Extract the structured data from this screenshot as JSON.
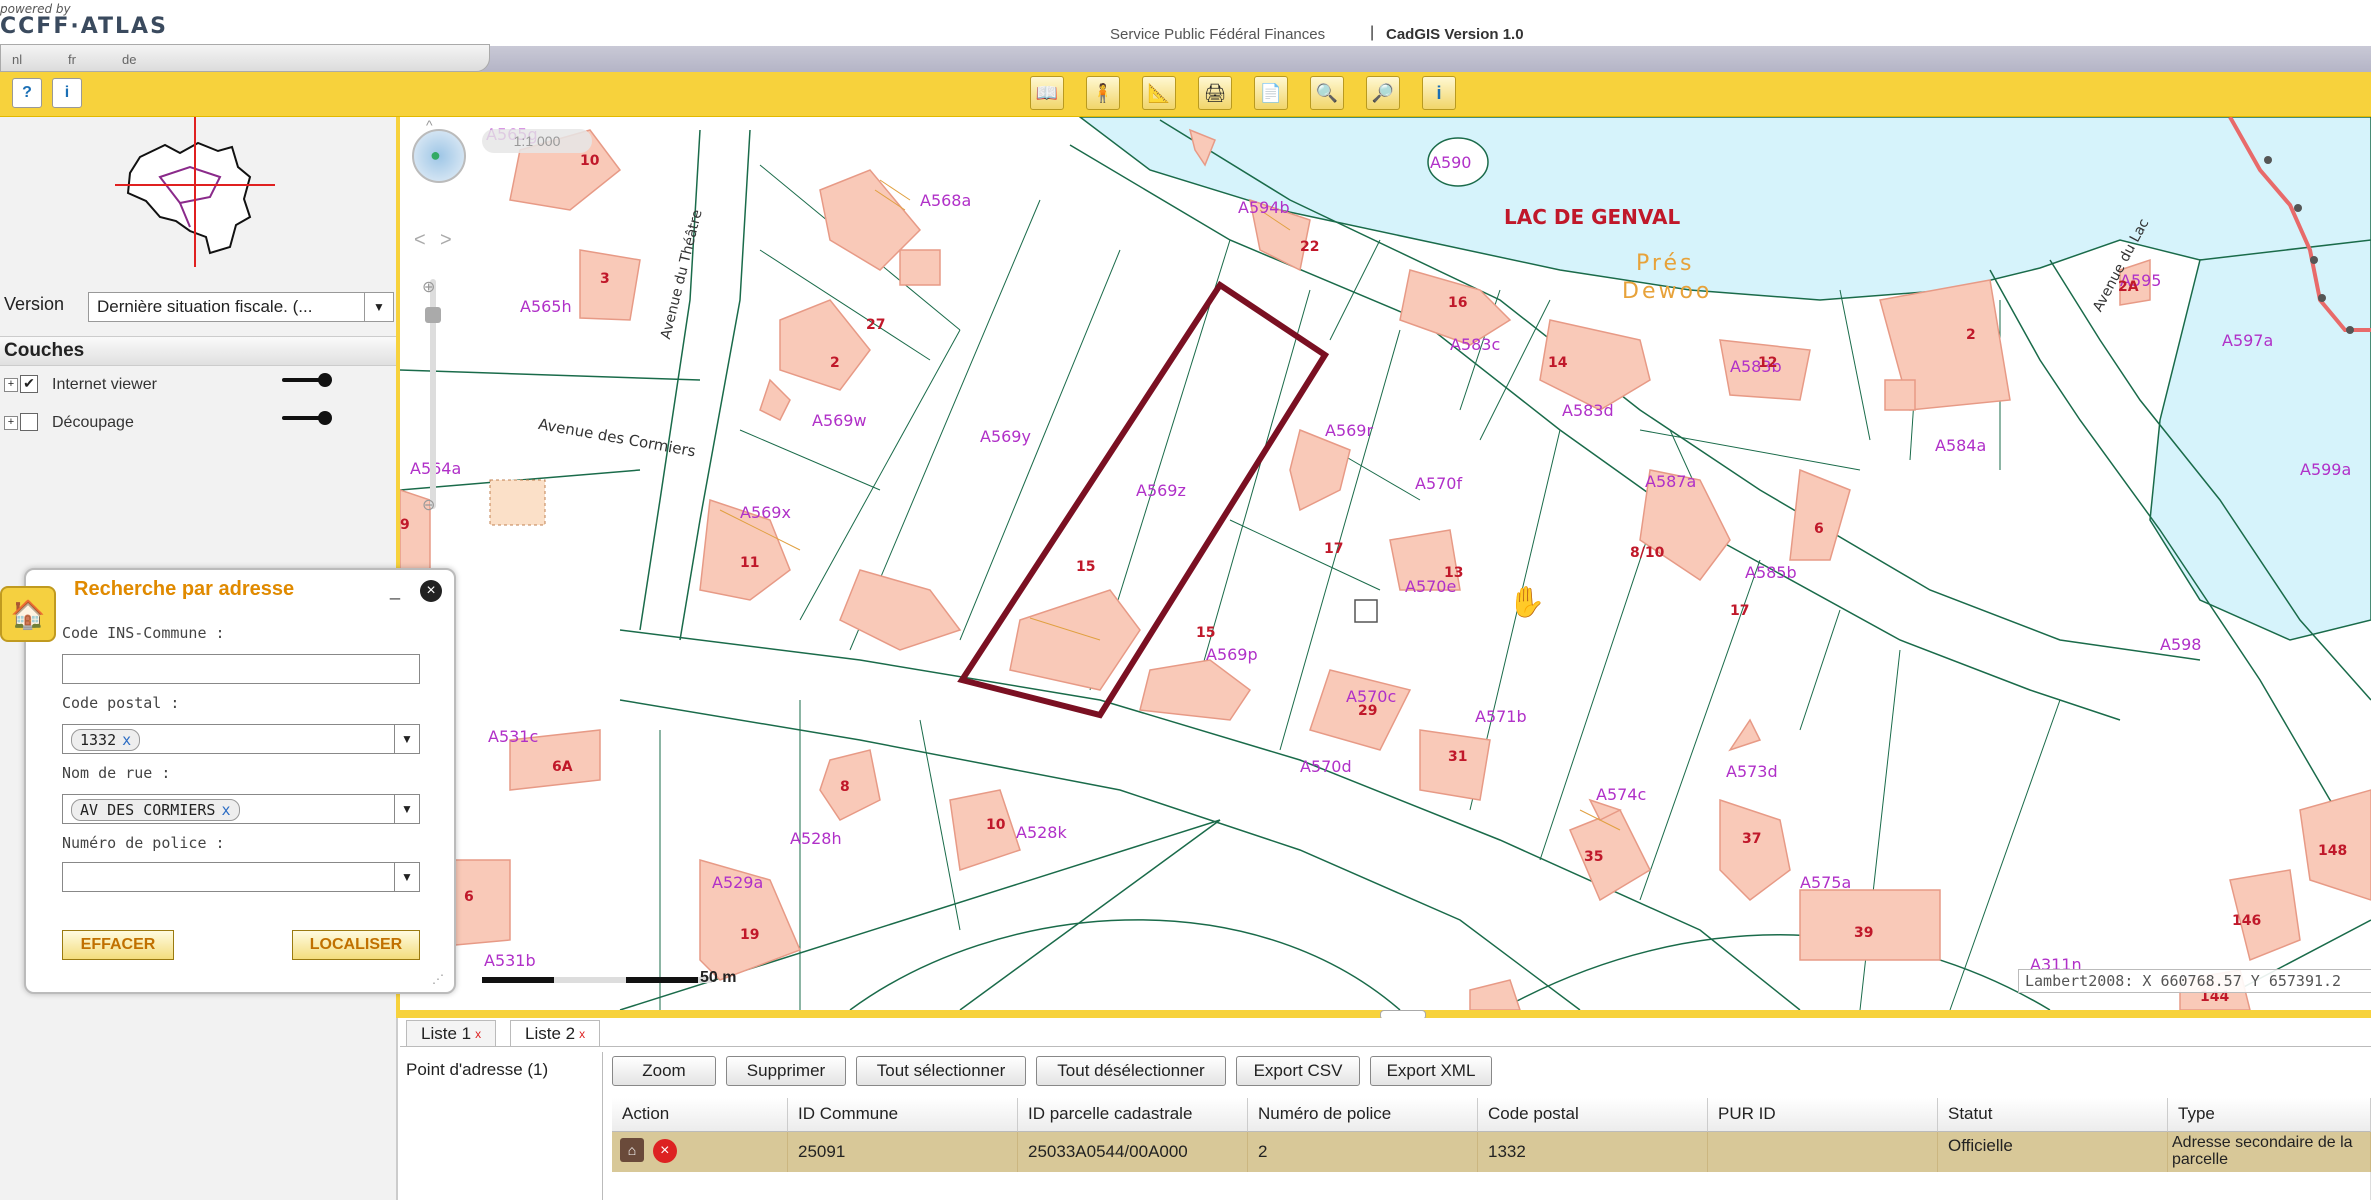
{
  "header": {
    "powered_by": "powered by",
    "logo": "CCFF·ATLAS",
    "service": "Service Public Fédéral Finances",
    "separator": "|",
    "app_name": "CadGIS   Version   1.0",
    "languages": [
      "nl",
      "fr",
      "de"
    ]
  },
  "toolbar": {
    "help_icon": "question-icon",
    "info_icon": "info-icon",
    "tools": [
      "book-icon",
      "person-map-icon",
      "ruler-icon",
      "print-icon",
      "document-icon",
      "zoom-in-icon",
      "zoom-out-icon",
      "info-icon"
    ]
  },
  "left_panel": {
    "version_label": "Version",
    "version_value": "Dernière situation fiscale. (...",
    "couches_title": "Couches",
    "layers": [
      {
        "name": "Internet viewer",
        "checked": true
      },
      {
        "name": "Découpage",
        "checked": false
      }
    ]
  },
  "map": {
    "scale_label": "1:1 000",
    "scalebar_label": "50 m",
    "lake_label": "LAC DE GENVAL",
    "place_label_1": "Prés",
    "place_label_2": "Dewoo",
    "coords": "Lambert2008: X 660768.57 Y 657391.2",
    "streets": [
      "Avenue du Théâtre",
      "Avenue des Cormiers",
      "Avenue du Lac"
    ],
    "parcels": [
      "A565g",
      "A568a",
      "A590",
      "A594b",
      "A565h",
      "A583c",
      "A569y",
      "A569z",
      "A569w",
      "A583d",
      "A583b",
      "A584a",
      "A597a",
      "A595",
      "A564a",
      "A569r",
      "A587a",
      "A599a",
      "A569x",
      "A570f",
      "A570e",
      "A585b",
      "A598",
      "A569p",
      "A570c",
      "A571b",
      "A531c",
      "A570d",
      "A574c",
      "A573d",
      "A528h",
      "A528k",
      "A529a",
      "A575a",
      "A531b",
      "A311n"
    ],
    "houses": [
      "10",
      "27",
      "22",
      "3",
      "16",
      "2",
      "14",
      "12",
      "2",
      "2A",
      "17",
      "8/10",
      "6",
      "11",
      "15",
      "13",
      "15",
      "17",
      "29",
      "31",
      "6A",
      "8",
      "10",
      "35",
      "37",
      "148",
      "19",
      "39",
      "146",
      "6",
      "9",
      "144"
    ]
  },
  "search_popup": {
    "title": "Recherche par adresse",
    "fields": {
      "ins_label": "Code INS-Commune :",
      "ins_value": "",
      "postal_label": "Code postal :",
      "postal_value": "1332",
      "street_label": "Nom de rue :",
      "street_value": "AV DES CORMIERS",
      "number_label": "Numéro de police :",
      "number_value": ""
    },
    "clear_button": "EFFACER",
    "locate_button": "LOCALISER"
  },
  "results": {
    "tabs": [
      {
        "label": "Liste 1",
        "close": "x"
      },
      {
        "label": "Liste 2",
        "close": "x"
      }
    ],
    "left_item": "Point d'adresse (1)",
    "buttons": [
      "Zoom",
      "Supprimer",
      "Tout sélectionner",
      "Tout désélectionner",
      "Export CSV",
      "Export XML"
    ],
    "columns": [
      "Action",
      "ID Commune",
      "ID parcelle cadastrale",
      "Numéro de police",
      "Code postal",
      "PUR ID",
      "Statut",
      "Type"
    ],
    "rows": [
      {
        "id_commune": "25091",
        "id_parcelle": "25033A0544/00A000",
        "numero": "2",
        "code_postal": "1332",
        "pur_id": "",
        "statut": "Officielle",
        "type": "Adresse secondaire de la parcelle"
      }
    ]
  },
  "colors": {
    "accent_yellow": "#f7d23c",
    "parcel_fill": "#f9c9b8",
    "parcel_stroke": "#e79a86",
    "lake": "#d6f3fb",
    "selected_outline": "#7a1022",
    "label_magenta": "#b030c8",
    "row_highlight": "#d8c898"
  }
}
